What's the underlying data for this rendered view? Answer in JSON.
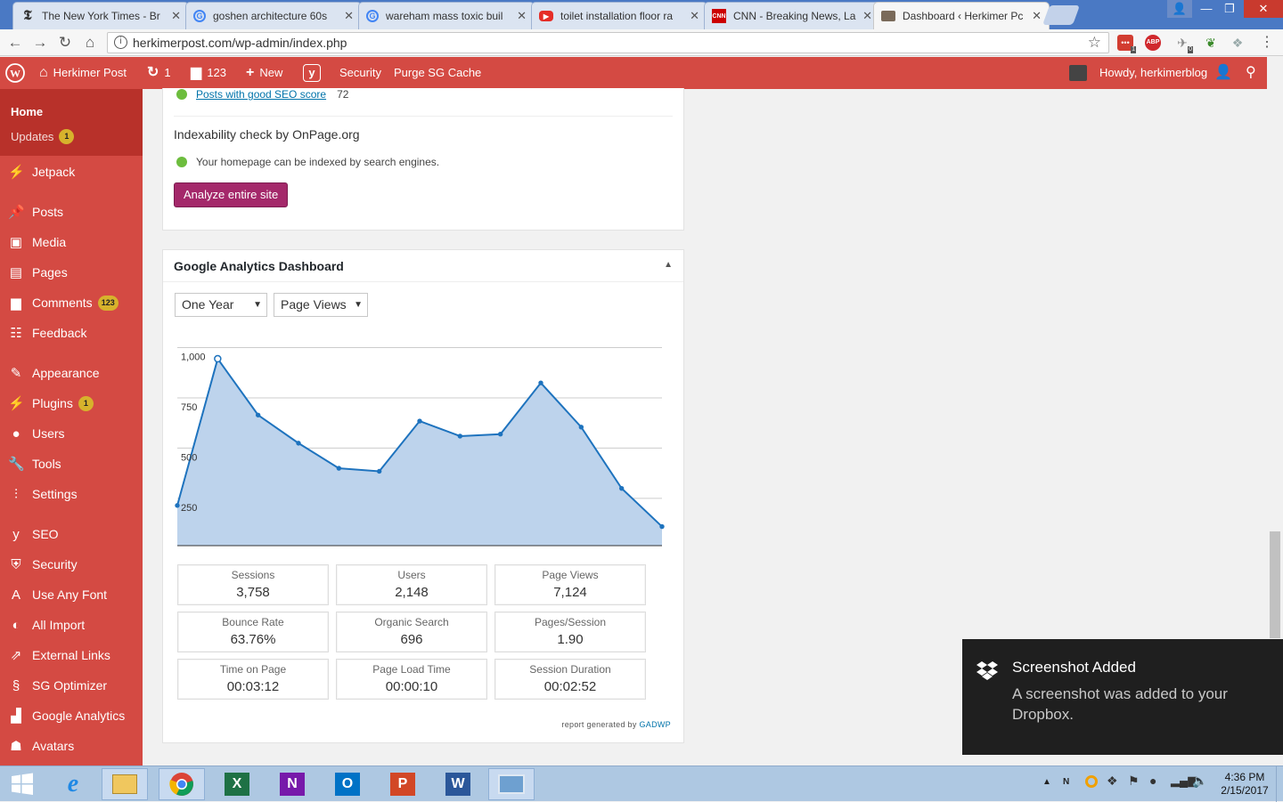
{
  "browser": {
    "tabs": [
      {
        "title": "The New York Times - Br",
        "icon": "nyt-icon"
      },
      {
        "title": "goshen architecture 60s",
        "icon": "google-icon"
      },
      {
        "title": "wareham mass toxic buil",
        "icon": "google-icon"
      },
      {
        "title": "toilet installation floor ra",
        "icon": "youtube-icon"
      },
      {
        "title": "CNN - Breaking News, La",
        "icon": "cnn-icon"
      },
      {
        "title": "Dashboard ‹ Herkimer Pc",
        "icon": "site-icon"
      }
    ],
    "url": "herkimerpost.com/wp-admin/index.php",
    "ext_abp": "ABP",
    "ext_badge1": "1",
    "ext_badge2": "0"
  },
  "adminbar": {
    "site_name": "Herkimer Post",
    "updates_count": "1",
    "comments_count": "123",
    "new_label": "New",
    "security_label": "Security",
    "purge_label": "Purge SG Cache",
    "howdy": "Howdy, herkimerblog"
  },
  "sidebar": {
    "home": "Home",
    "updates": "Updates",
    "updates_badge": "1",
    "items": [
      {
        "label": "Jetpack",
        "icon": "jetpack-icon"
      },
      {
        "label": "Posts",
        "icon": "pin-icon"
      },
      {
        "label": "Media",
        "icon": "media-icon"
      },
      {
        "label": "Pages",
        "icon": "pages-icon"
      },
      {
        "label": "Comments",
        "icon": "comment-icon",
        "badge": "123"
      },
      {
        "label": "Feedback",
        "icon": "feedback-icon"
      },
      {
        "label": "Appearance",
        "icon": "brush-icon"
      },
      {
        "label": "Plugins",
        "icon": "plug-icon",
        "badge": "1"
      },
      {
        "label": "Users",
        "icon": "user-icon"
      },
      {
        "label": "Tools",
        "icon": "wrench-icon"
      },
      {
        "label": "Settings",
        "icon": "settings-icon"
      },
      {
        "label": "SEO",
        "icon": "yoast-icon"
      },
      {
        "label": "Security",
        "icon": "shield-icon"
      },
      {
        "label": "Use Any Font",
        "icon": "font-icon"
      },
      {
        "label": "All Import",
        "icon": "import-icon"
      },
      {
        "label": "External Links",
        "icon": "external-link-icon"
      },
      {
        "label": "SG Optimizer",
        "icon": "sg-icon"
      },
      {
        "label": "Google Analytics",
        "icon": "chart-icon"
      },
      {
        "label": "Avatars",
        "icon": "avatar-icon"
      }
    ]
  },
  "seo": {
    "good_posts_link": "Posts with good SEO score",
    "good_posts_count": "72",
    "index_heading": "Indexability check by OnPage.org",
    "index_status": "Your homepage can be indexed by search engines.",
    "analyze_button": "Analyze entire site"
  },
  "ga": {
    "title": "Google Analytics Dashboard",
    "period_select": "One Year",
    "metric_select": "Page Views",
    "stats": [
      {
        "label": "Sessions",
        "value": "3,758"
      },
      {
        "label": "Users",
        "value": "2,148"
      },
      {
        "label": "Page Views",
        "value": "7,124"
      },
      {
        "label": "Bounce Rate",
        "value": "63.76%"
      },
      {
        "label": "Organic Search",
        "value": "696"
      },
      {
        "label": "Pages/Session",
        "value": "1.90"
      },
      {
        "label": "Time on Page",
        "value": "00:03:12"
      },
      {
        "label": "Page Load Time",
        "value": "00:00:10"
      },
      {
        "label": "Session Duration",
        "value": "00:02:52"
      }
    ],
    "footer_text": "report generated by",
    "footer_link": "GADWP"
  },
  "chart_data": {
    "type": "area",
    "yticks": [
      "1,000",
      "750",
      "500",
      "250"
    ],
    "ylim": [
      50,
      1060
    ],
    "values": [
      250,
      980,
      700,
      560,
      435,
      420,
      670,
      595,
      605,
      860,
      640,
      335,
      145
    ],
    "color": "#1e73be",
    "fill": "#bdd3ec",
    "grid": true
  },
  "toast": {
    "title": "Screenshot Added",
    "body": "A screenshot was added to your Dropbox."
  },
  "taskbar": {
    "time": "4:36 PM",
    "date": "2/15/2017"
  },
  "colors": {
    "wp_red": "#d44a43",
    "wp_red_dark": "#b8312a",
    "button_purple": "#a4286a",
    "link_blue": "#1e73be"
  }
}
